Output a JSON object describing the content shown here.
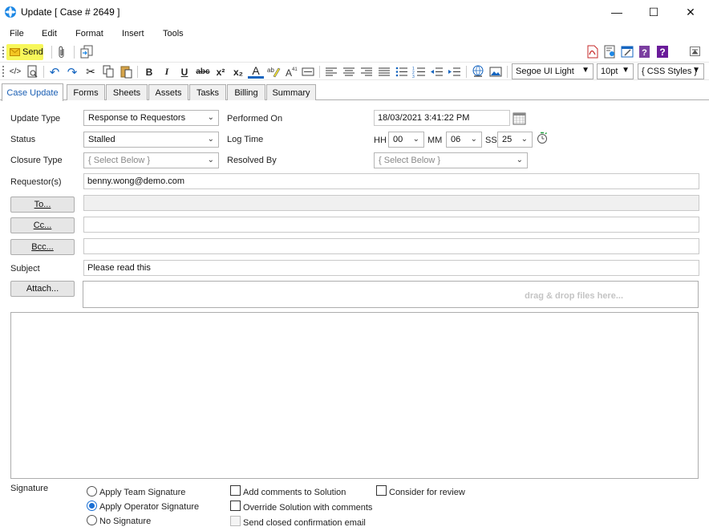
{
  "window": {
    "title": "Update [ Case # 2649 ]",
    "min_glyph": "—",
    "max_glyph": "☐",
    "close_glyph": "✕"
  },
  "menu": [
    "File",
    "Edit",
    "Format",
    "Insert",
    "Tools"
  ],
  "toolbar1": {
    "send_label": "Send",
    "highlight_color": "#f7f75a"
  },
  "toolbar2": {
    "font_name": "Segoe UI Light",
    "font_size": "10pt",
    "css_styles": "{ CSS Styles }",
    "glyphs": {
      "source": "</>",
      "undo": "↶",
      "redo": "↷",
      "cut": "✂",
      "bold": "B",
      "italic": "I",
      "underline": "U",
      "strike": "abc",
      "superscript": "x²",
      "subscript": "x₂",
      "font_color": "A"
    }
  },
  "tabs": [
    "Case Update",
    "Forms",
    "Sheets",
    "Assets",
    "Tasks",
    "Billing",
    "Summary"
  ],
  "form": {
    "update_type_label": "Update Type",
    "update_type_value": "Response to Requestors",
    "status_label": "Status",
    "status_value": "Stalled",
    "closure_type_label": "Closure Type",
    "closure_type_value": "{ Select Below }",
    "performed_on_label": "Performed On",
    "performed_on_value": "18/03/2021 3:41:22 PM",
    "log_time_label": "Log Time",
    "hh_label": "HH",
    "hh_value": "00",
    "mm_label": "MM",
    "mm_value": "06",
    "ss_label": "SS",
    "ss_value": "25",
    "resolved_by_label": "Resolved By",
    "resolved_by_value": "{ Select Below }",
    "requestors_label": "Requestor(s)",
    "requestors_value": "benny.wong@demo.com",
    "to_label": "To...",
    "cc_label": "Cc...",
    "bcc_label": "Bcc...",
    "subject_label": "Subject",
    "subject_value": "Please read this",
    "attach_label": "Attach...",
    "dropzone_text": "drag & drop files here..."
  },
  "signature": {
    "label": "Signature",
    "options": [
      "Apply Team Signature",
      "Apply Operator Signature",
      "No Signature"
    ],
    "selected_index": 1,
    "checkboxes": {
      "add_comments": "Add comments to Solution",
      "override_solution": "Override Solution with comments",
      "send_closed": "Send closed confirmation email",
      "consider_review": "Consider for review"
    }
  },
  "colors": {
    "accent": "#1a6fd4",
    "active_tab_text": "#1a5fb4"
  }
}
